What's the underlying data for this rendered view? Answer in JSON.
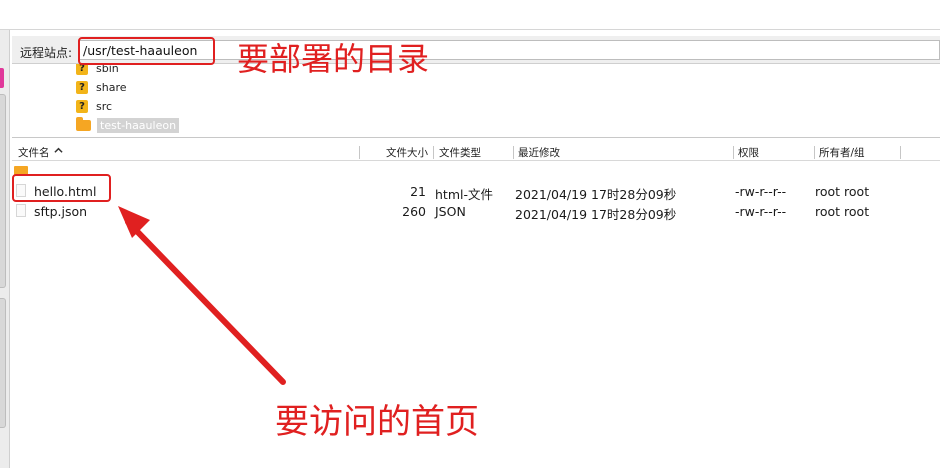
{
  "remote_site": {
    "label": "远程站点:",
    "path": "/usr/test-haauleon"
  },
  "tree": {
    "items": [
      {
        "name": "sbin",
        "icon": "question-icon"
      },
      {
        "name": "share",
        "icon": "question-icon"
      },
      {
        "name": "src",
        "icon": "question-icon"
      },
      {
        "name": "test-haauleon",
        "icon": "folder-icon",
        "selected": true
      }
    ]
  },
  "file_list": {
    "columns": [
      "文件名",
      "文件大小",
      "文件类型",
      "最近修改",
      "权限",
      "所有者/组"
    ],
    "rows": [
      {
        "name": "hello.html",
        "size": "21",
        "type": "html-文件",
        "modified": "2021/04/19 17时28分09秒",
        "permissions": "-rw-r--r--",
        "owner": "root root"
      },
      {
        "name": "sftp.json",
        "size": "260",
        "type": "JSON",
        "modified": "2021/04/19 17时28分09秒",
        "permissions": "-rw-r--r--",
        "owner": "root root"
      }
    ]
  },
  "annotations": {
    "deploy_dir": "要部署的目录",
    "home_page": "要访问的首页",
    "color": "#e02020"
  }
}
